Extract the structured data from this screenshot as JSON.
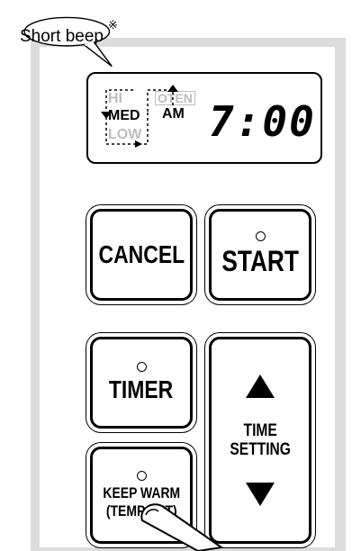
{
  "callout": {
    "text": "Short beep",
    "mark": "※"
  },
  "display": {
    "levels": [
      "HI",
      "MED",
      "LOW"
    ],
    "oten_label": "OTEN",
    "ampm": "AM",
    "time": "7:00",
    "active_level": "MED",
    "active_color": "#000000",
    "inactive_color": "#bdbdbd"
  },
  "buttons": {
    "cancel": "CANCEL",
    "start": "START",
    "timer": "TIMER",
    "time_setting_line1": "TIME",
    "time_setting_line2": "SETTING",
    "keep_warm_line1": "KEEP WARM",
    "keep_warm_line2": "(TEMP SET)"
  },
  "icons": {
    "up": "up-triangle-icon",
    "down": "down-triangle-icon",
    "indicator": "indicator-led-icon",
    "hand": "pressing-finger-icon"
  },
  "colors": {
    "panel_border": "#dcdcdc",
    "ink": "#000000"
  }
}
